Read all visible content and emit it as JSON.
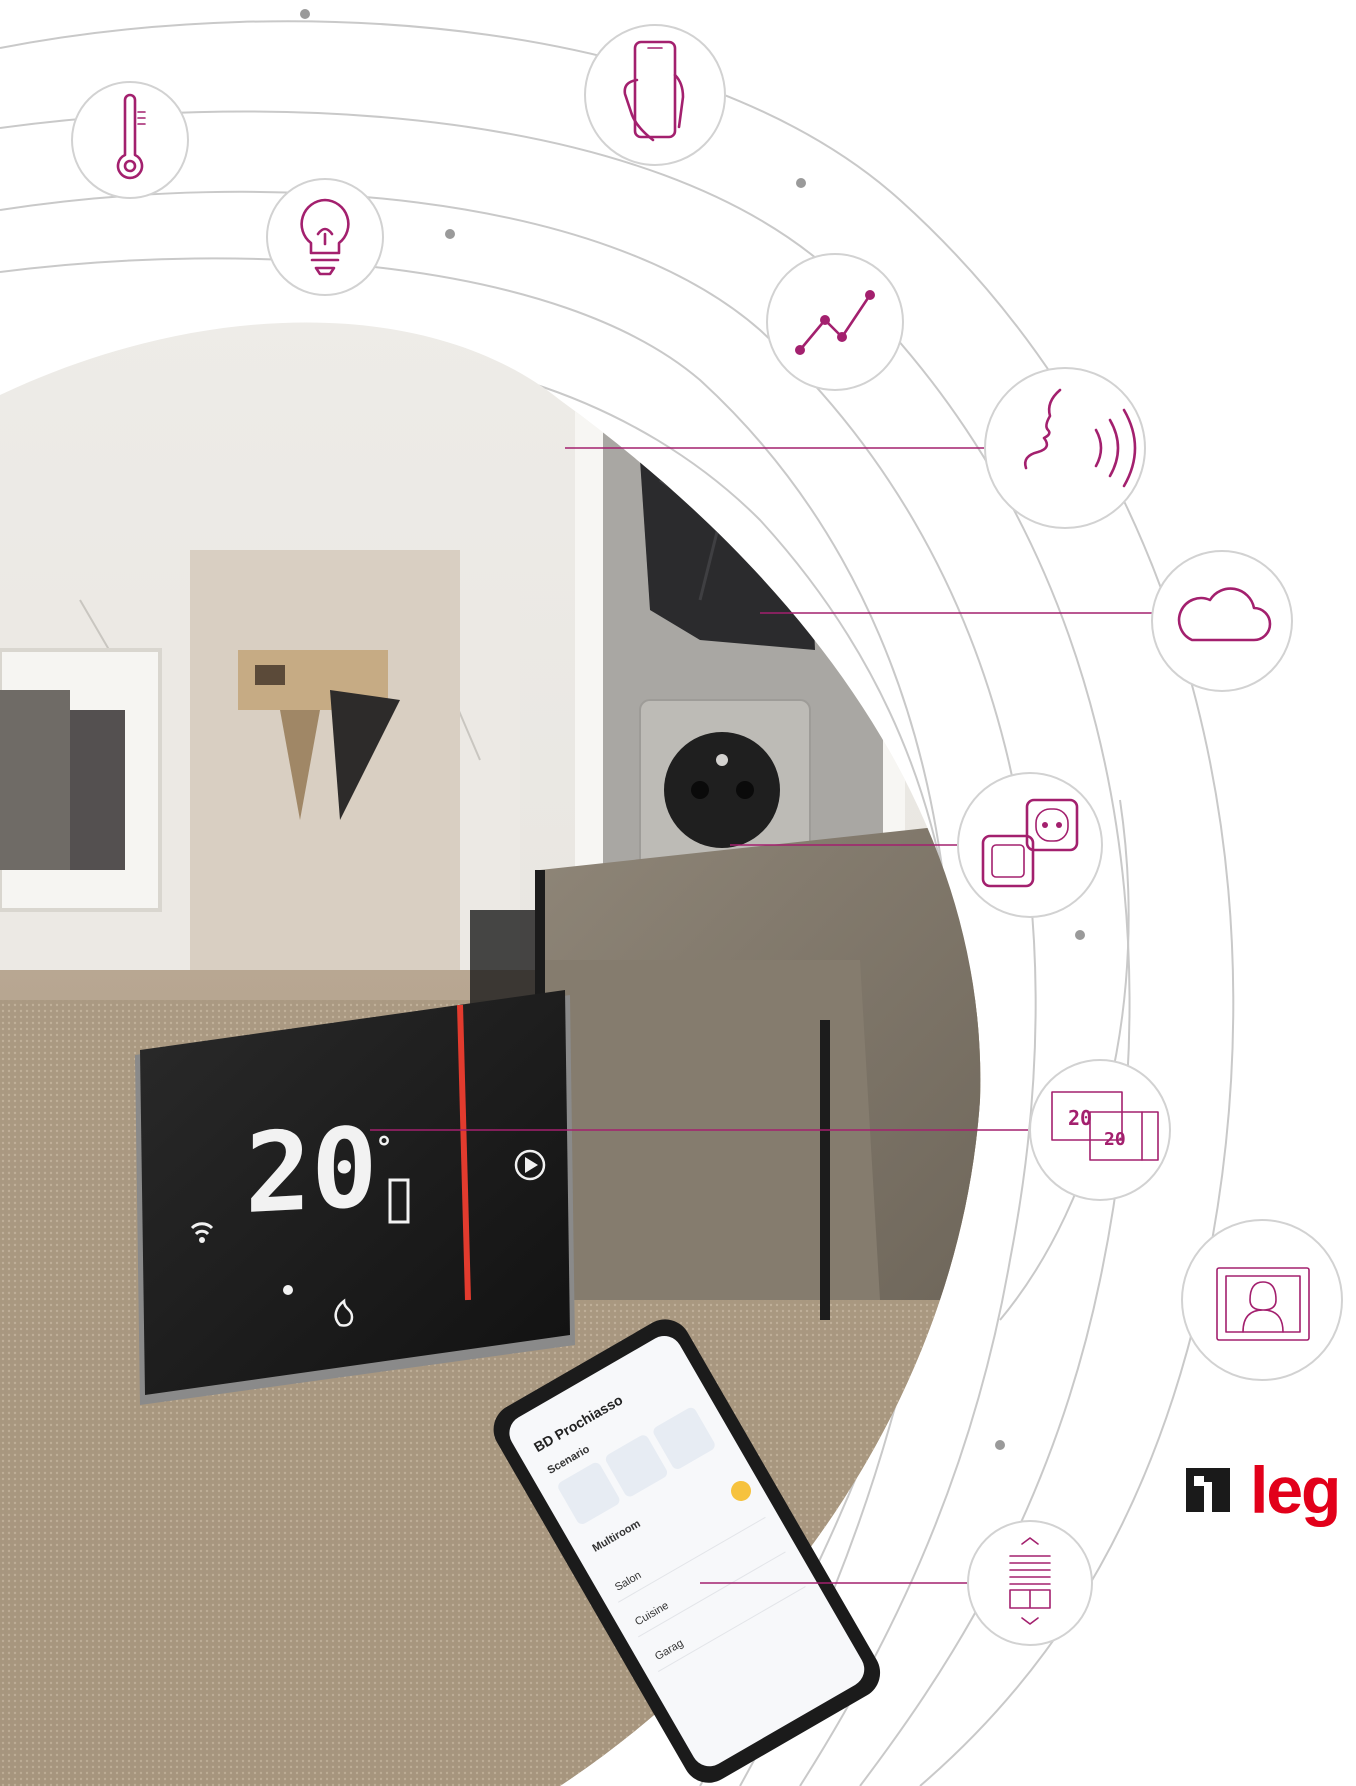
{
  "brand": {
    "logo_text": "leg",
    "logo_color": "#e2001a",
    "mark_color": "#1a1a1a"
  },
  "colors": {
    "accent": "#a3206e",
    "orbit": "#c9c9c9",
    "badge_border": "#d2d2d2",
    "thermostat_bar": "#e23b2e"
  },
  "thermostat": {
    "temperature": "20",
    "degree_symbol": "°",
    "status_icons": [
      "wifi-icon",
      "flame-icon",
      "play-icon"
    ]
  },
  "mini_thermostats": {
    "display_a": "20",
    "display_b": "20"
  },
  "feature_icons": [
    "thermometer-icon",
    "lightbulb-icon",
    "smartphone-icon",
    "trend-chart-icon",
    "voice-assistant-icon",
    "cloud-icon",
    "socket-switch-icon",
    "thermostat-icon",
    "video-intercom-icon",
    "shutter-icon"
  ],
  "phone_app": {
    "title": "BD Prochiasso",
    "section_1": "Scenario",
    "section_2": "Multiroom",
    "rooms": [
      "Salon",
      "Cuisine",
      "Garag"
    ]
  }
}
